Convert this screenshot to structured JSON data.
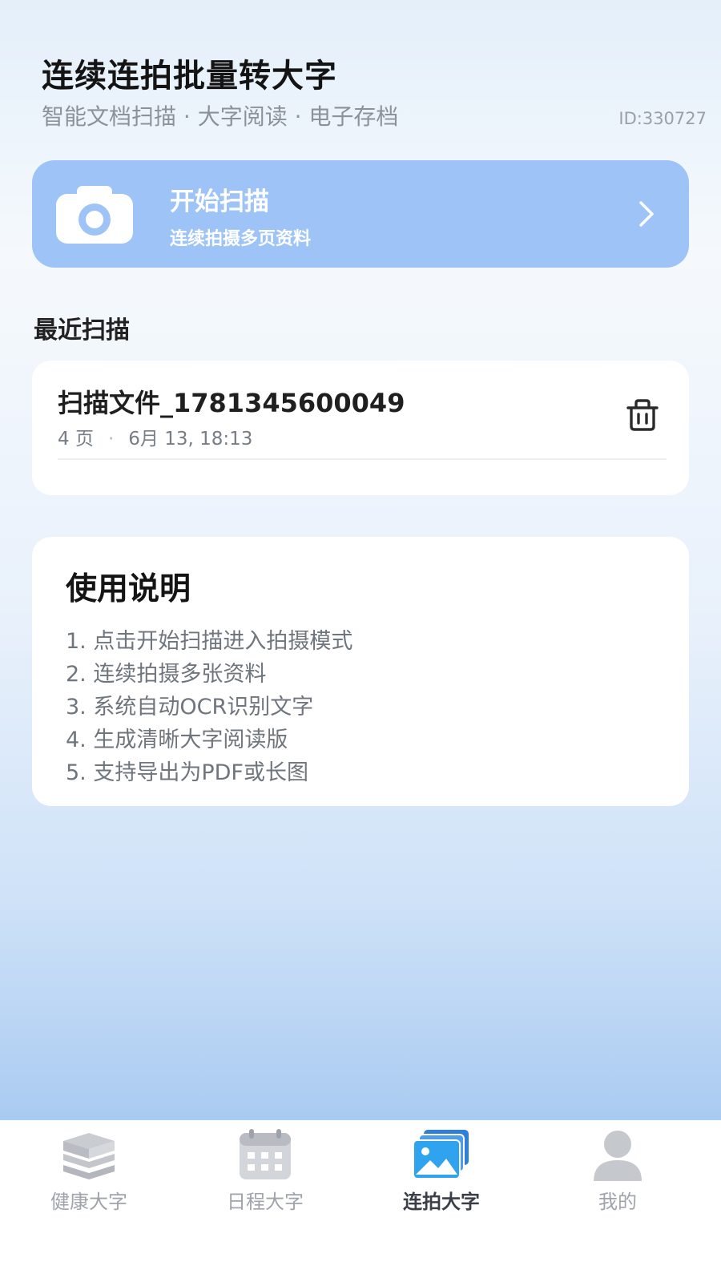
{
  "header": {
    "title": "连续连拍批量转大字",
    "subtitle": "智能文档扫描 · 大字阅读 · 电子存档",
    "user_id": "ID:330727"
  },
  "scan_banner": {
    "title": "开始扫描",
    "subtitle": "连续拍摄多页资料",
    "icon": "camera-icon",
    "action_icon": "chevron-right-icon",
    "color": "#9ec3f6"
  },
  "recent": {
    "section_title": "最近扫描",
    "items": [
      {
        "name": "扫描文件_1781345600049",
        "pages": "4 页",
        "separator": "·",
        "date": "6月 13, 18:13",
        "delete_icon": "trash-icon"
      }
    ]
  },
  "guide": {
    "title": "使用说明",
    "steps": [
      "1. 点击开始扫描进入拍摄模式",
      "2. 连续拍摄多张资料",
      "3. 系统自动OCR识别文字",
      "4. 生成清晰大字阅读版",
      "5. 支持导出为PDF或长图"
    ]
  },
  "bottom_nav": {
    "active_index": 2,
    "items": [
      {
        "label": "健康大字",
        "icon": "book-stack-icon"
      },
      {
        "label": "日程大字",
        "icon": "calendar-icon"
      },
      {
        "label": "连拍大字",
        "icon": "photo-stack-icon"
      },
      {
        "label": "我的",
        "icon": "user-icon"
      }
    ]
  }
}
